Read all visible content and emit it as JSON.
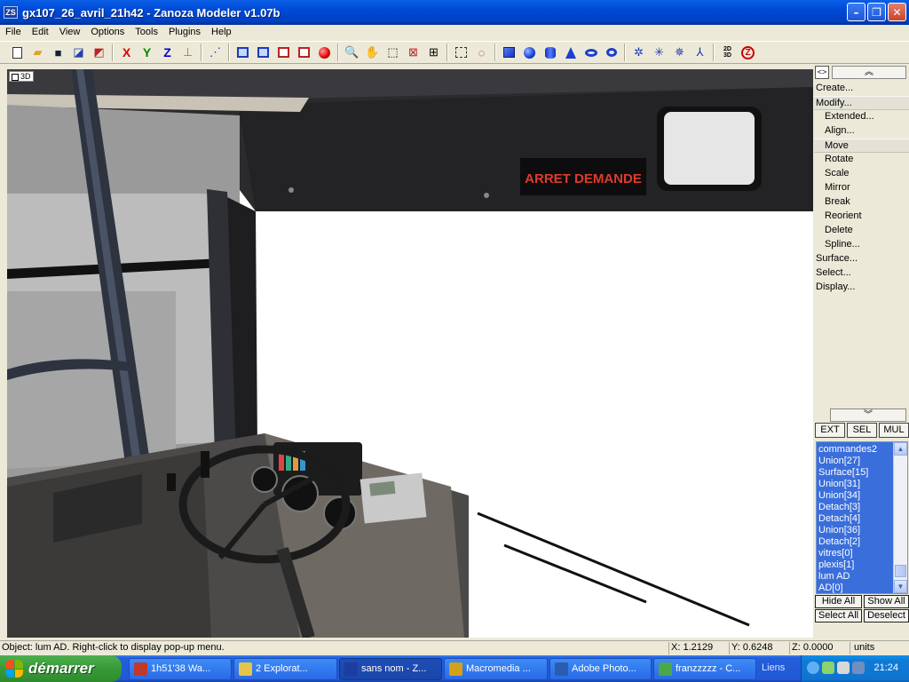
{
  "window": {
    "title": "gx107_26_avril_21h42 - Zanoza Modeler v1.07b",
    "app_icon_text": "ZS"
  },
  "menu": [
    "File",
    "Edit",
    "View",
    "Options",
    "Tools",
    "Plugins",
    "Help"
  ],
  "toolbar": {
    "axes": [
      "X",
      "Y",
      "Z"
    ],
    "mode_2d3d_top": "2D",
    "mode_2d3d_bottom": "3D",
    "zanoza_logo": "Z"
  },
  "viewport": {
    "label": "3D",
    "sign_text": "ARRET DEMANDE"
  },
  "panel": {
    "collapse_glyph": "<>",
    "scroll_up_glyph": "︽",
    "scroll_down_glyph": "︾",
    "commands": [
      {
        "label": "Create...",
        "sub": false,
        "selected": false
      },
      {
        "label": "Modify...",
        "sub": false,
        "selected": true
      },
      {
        "label": "Extended...",
        "sub": true,
        "selected": false
      },
      {
        "label": "Align...",
        "sub": true,
        "selected": false
      },
      {
        "label": "Move",
        "sub": true,
        "selected": true
      },
      {
        "label": "Rotate",
        "sub": true,
        "selected": false
      },
      {
        "label": "Scale",
        "sub": true,
        "selected": false
      },
      {
        "label": "Mirror",
        "sub": true,
        "selected": false
      },
      {
        "label": "Break",
        "sub": true,
        "selected": false
      },
      {
        "label": "Reorient",
        "sub": true,
        "selected": false
      },
      {
        "label": "Delete",
        "sub": true,
        "selected": false
      },
      {
        "label": "Spline...",
        "sub": true,
        "selected": false
      },
      {
        "label": "Surface...",
        "sub": false,
        "selected": false
      },
      {
        "label": "Select...",
        "sub": false,
        "selected": false
      },
      {
        "label": "Display...",
        "sub": false,
        "selected": false
      }
    ],
    "modes": [
      "EXT",
      "SEL",
      "MUL"
    ],
    "objects": [
      "commandes2",
      "Union[27]",
      "Surface[15]",
      "Union[31]",
      "Union[34]",
      "Detach[3]",
      "Detach[4]",
      "Union[36]",
      "Detach[2]",
      "vitres[0]",
      "plexis[1]",
      "lum AD",
      "AD[0]"
    ],
    "buttons": {
      "hide_all": "Hide All",
      "show_all": "Show All",
      "select_all": "Select All",
      "deselect": "Deselect"
    }
  },
  "status": {
    "message": "Object: lum AD. Right-click to display pop-up menu.",
    "x": "X: 1.2129",
    "y": "Y: 0.6248",
    "z": "Z: 0.0000",
    "units": "units"
  },
  "taskbar": {
    "start": "démarrer",
    "tasks": [
      {
        "label": "1h51'38 Wa...",
        "color": "#c0392b"
      },
      {
        "label": "2 Explorat...",
        "color": "#e6c34a"
      },
      {
        "label": "sans nom - Z...",
        "color": "#1d3d9e"
      },
      {
        "label": "Macromedia ...",
        "color": "#d4a017"
      },
      {
        "label": "Adobe Photo...",
        "color": "#2a5db0"
      },
      {
        "label": "franzzzzz - C...",
        "color": "#4aa84a"
      }
    ],
    "links": "Liens",
    "clock": "21:24"
  }
}
